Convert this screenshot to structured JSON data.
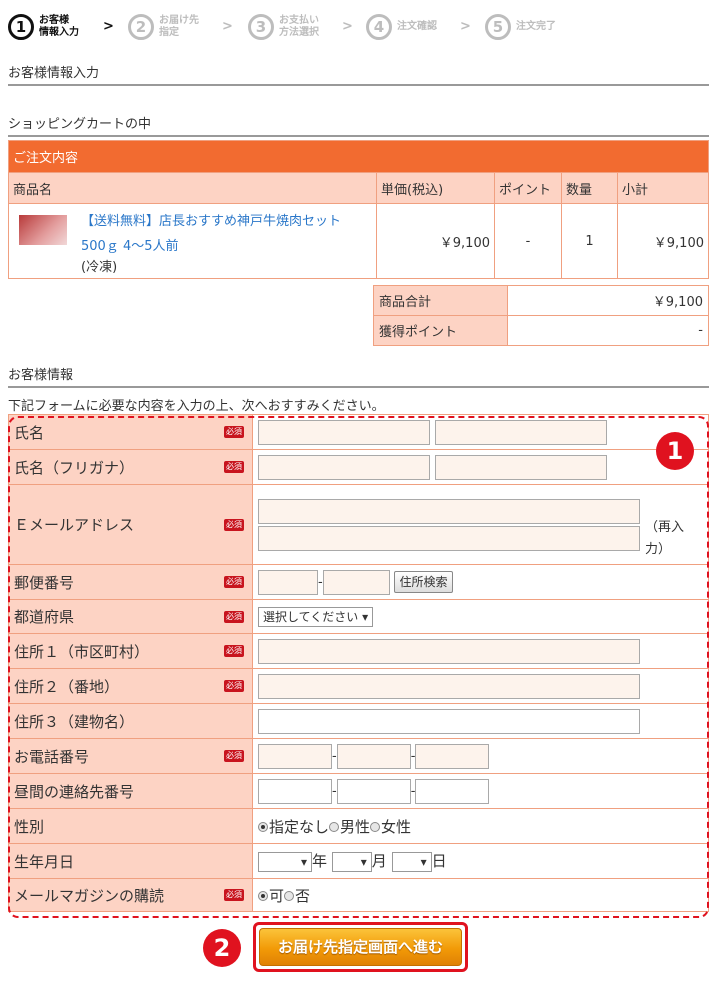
{
  "steps": [
    {
      "num": "1",
      "label": "お客様\n情報入力"
    },
    {
      "num": "2",
      "label": "お届け先\n指定"
    },
    {
      "num": "3",
      "label": "お支払い\n方法選択"
    },
    {
      "num": "4",
      "label": "注文確認"
    },
    {
      "num": "5",
      "label": "注文完了"
    }
  ],
  "step_arrow": ">",
  "sections": {
    "customer_input": "お客様情報入力",
    "cart": "ショッピングカートの中",
    "customer_info": "お客様情報"
  },
  "cart": {
    "header": "ご注文内容",
    "columns": [
      "商品名",
      "単価(税込)",
      "ポイント",
      "数量",
      "小計"
    ],
    "item": {
      "name_line1": "【送料無料】店長おすすめ神戸牛焼肉セット",
      "name_line2": "500ｇ 4～5人前",
      "note": "(冷凍)",
      "price": "￥9,100",
      "points": "-",
      "qty": "1",
      "subtotal": "￥9,100"
    }
  },
  "totals": {
    "total_label": "商品合計",
    "total_value": "￥9,100",
    "points_label": "獲得ポイント",
    "points_value": "-"
  },
  "intro": "下記フォームに必要な内容を入力の上、次へおすすみください。",
  "required_badge": "必須",
  "form": {
    "name": "氏名",
    "kana": "氏名（フリガナ）",
    "email": "Ｅメールアドレス",
    "email_again": "（再入力）",
    "zip": "郵便番号",
    "zip_sep": "-",
    "zip_btn": "住所検索",
    "pref": "都道府県",
    "pref_select": "選択してください ▾",
    "addr1": "住所１（市区町村）",
    "addr2": "住所２（番地）",
    "addr3": "住所３（建物名）",
    "tel": "お電話番号",
    "daytel": "昼間の連絡先番号",
    "sep": "-",
    "gender": "性別",
    "gender_opts": [
      "指定なし",
      "男性",
      "女性"
    ],
    "birth": "生年月日",
    "birth_sel": "▾",
    "year": "年",
    "month": "月",
    "day": "日",
    "mag": "メールマガジンの購読",
    "mag_opts": [
      "可",
      "否"
    ]
  },
  "callouts": {
    "one": "1",
    "two": "2"
  },
  "submit": "お届け先指定画面へ進む"
}
